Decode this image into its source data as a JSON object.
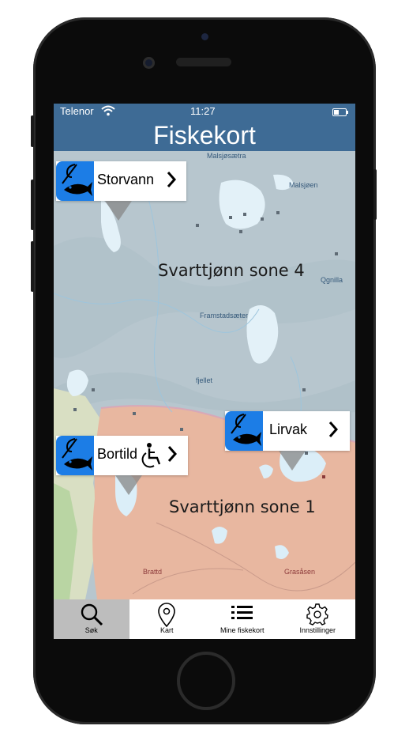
{
  "status_bar": {
    "carrier": "Telenor",
    "time": "11:27",
    "battery_percent": 40
  },
  "header": {
    "title": "Fiskekort"
  },
  "map": {
    "zones": [
      "Svarttjønn sone 4",
      "Svarttjønn sone 1"
    ],
    "places": [
      "Malsjøsætra",
      "Malsjøen",
      "Framstadsæter",
      "fjellet",
      "Qgnilla",
      "Brattd",
      "Grasåsen"
    ],
    "colors": {
      "zone4": "#b9c7cf",
      "zone1": "#e9b8a1",
      "water": "#dbeef8"
    }
  },
  "callouts": [
    {
      "name": "Storvann",
      "icon": "fish-hook-icon"
    },
    {
      "name": "Lirvak",
      "icon": "fish-hook-icon"
    },
    {
      "name": "Bortild",
      "icon": "fish-hook-icon",
      "accessibility": "wheelchair-icon"
    }
  ],
  "tabbar": {
    "tabs": [
      {
        "label": "Søk",
        "icon": "search-icon",
        "active": true
      },
      {
        "label": "Kart",
        "icon": "map-pin-icon",
        "active": false
      },
      {
        "label": "Mine fiskekort",
        "icon": "list-icon",
        "active": false
      },
      {
        "label": "Innstillinger",
        "icon": "gear-icon",
        "active": false
      }
    ]
  },
  "accent_color": "#3e6b95",
  "badge_color": "#1c7de6"
}
